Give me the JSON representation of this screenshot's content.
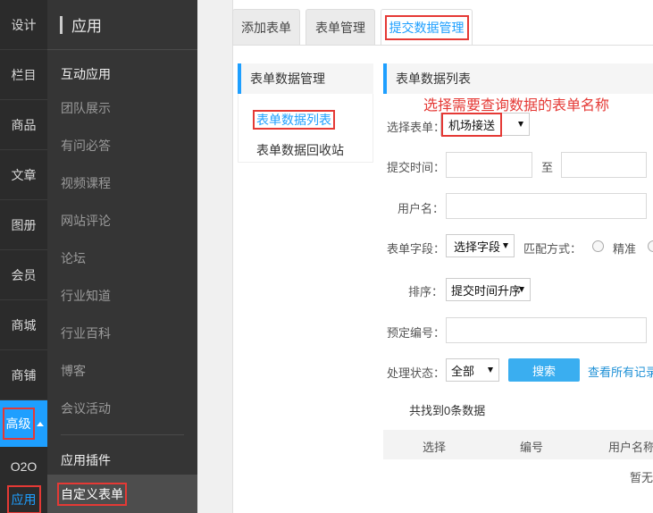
{
  "nav_primary": {
    "items": [
      "设计",
      "栏目",
      "商品",
      "文章",
      "图册",
      "会员",
      "商城",
      "商铺",
      "高级",
      "O2O",
      "应用"
    ]
  },
  "nav_secondary": {
    "title": "应用",
    "group1": "互动应用",
    "items": [
      "团队展示",
      "有问必答",
      "视频课程",
      "网站评论",
      "论坛",
      "行业知道",
      "行业百科",
      "博客",
      "会议活动"
    ],
    "group2": "应用插件",
    "active_item": "自定义表单"
  },
  "tabs": [
    "添加表单",
    "表单管理",
    "提交数据管理"
  ],
  "side_panel": {
    "title": "表单数据管理",
    "links": [
      "表单数据列表",
      "表单数据回收站"
    ]
  },
  "list": {
    "title": "表单数据列表",
    "annotation": "选择需要查询数据的表单名称",
    "form_label": "选择表单：",
    "form_value": "机场接送",
    "time_label": "提交时间：",
    "time_to": "至",
    "user_label": "用户名：",
    "field_label": "表单字段：",
    "field_value": "选择字段",
    "match_label": "匹配方式：",
    "match_exact": "精准",
    "sort_label": "排序：",
    "sort_value": "提交时间升序",
    "booking_label": "预定编号：",
    "status_label": "处理状态：",
    "status_value": "全部",
    "search_button": "搜索",
    "view_all": "查看所有记录",
    "result_text": "共找到0条数据",
    "columns": [
      "选择",
      "编号",
      "用户名称"
    ],
    "empty_text": "暂无"
  },
  "colors": {
    "accent": "#1e9fff",
    "highlight_box": "#e53935",
    "nav_dark": "#2b2b2b"
  }
}
